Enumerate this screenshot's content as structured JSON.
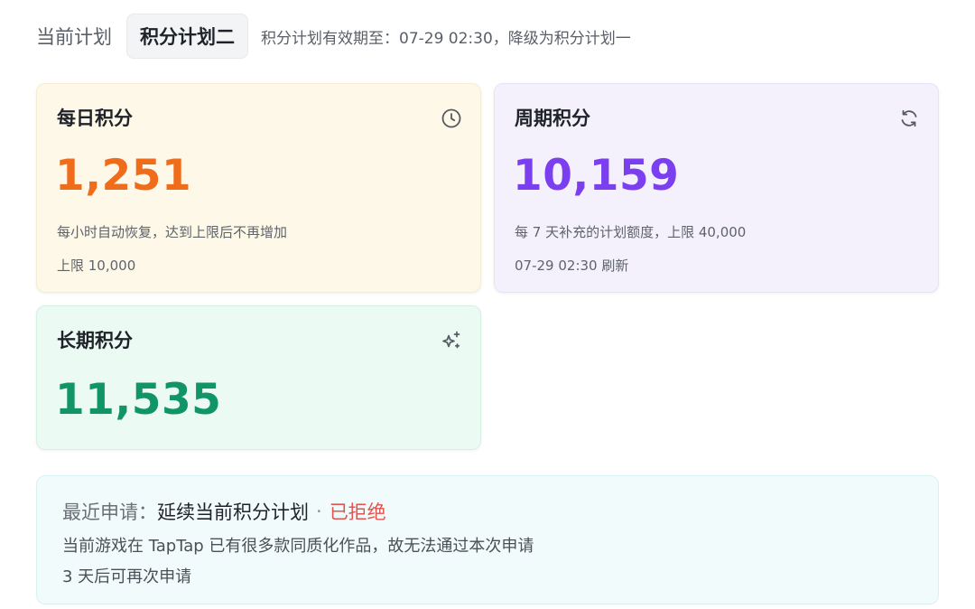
{
  "header": {
    "label": "当前计划",
    "current_plan": "积分计划二",
    "note": "积分计划有效期至：07-29 02:30，降级为积分计划一"
  },
  "daily": {
    "title": "每日积分",
    "icon": "clock-icon",
    "value": "1,251",
    "desc1": "每小时自动恢复，达到上限后不再增加",
    "desc2": "上限 10,000"
  },
  "period": {
    "title": "周期积分",
    "icon": "refresh-icon",
    "value": "10,159",
    "desc1": "每 7 天补充的计划额度，上限 40,000",
    "desc2": "07-29 02:30 刷新"
  },
  "longterm": {
    "title": "长期积分",
    "icon": "sparkles-icon",
    "value": "11,535"
  },
  "application": {
    "prefix": "最近申请：",
    "name": "延续当前积分计划",
    "separator": "·",
    "status": "已拒绝",
    "reason": "当前游戏在 TapTap 已有很多款同质化作品，故无法通过本次申请",
    "retry": "3 天后可再次申请"
  },
  "colors": {
    "daily_accent": "#ef6c1a",
    "period_accent": "#7b3ff0",
    "longterm_accent": "#129469",
    "rejected": "#e0554f"
  }
}
